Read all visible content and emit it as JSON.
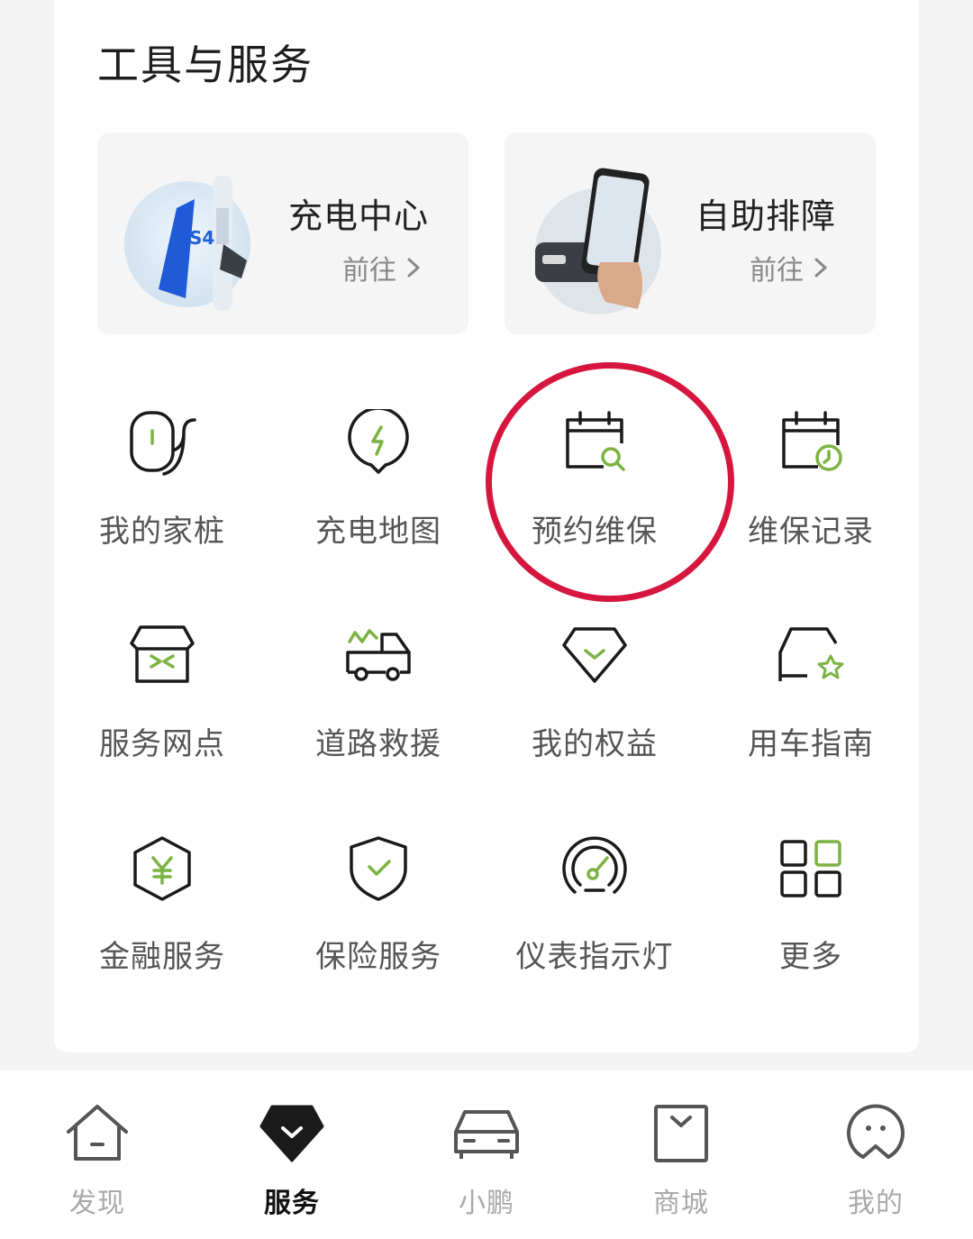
{
  "section": {
    "title": "工具与服务"
  },
  "features": [
    {
      "title": "充电中心",
      "link": "前往"
    },
    {
      "title": "自助排障",
      "link": "前往"
    }
  ],
  "tools": [
    {
      "label": "我的家桩",
      "icon": "home-charger-icon"
    },
    {
      "label": "充电地图",
      "icon": "charging-map-icon"
    },
    {
      "label": "预约维保",
      "icon": "maintenance-booking-icon"
    },
    {
      "label": "维保记录",
      "icon": "maintenance-record-icon"
    },
    {
      "label": "服务网点",
      "icon": "service-outlet-icon"
    },
    {
      "label": "道路救援",
      "icon": "road-rescue-icon"
    },
    {
      "label": "我的权益",
      "icon": "benefits-icon"
    },
    {
      "label": "用车指南",
      "icon": "car-guide-icon"
    },
    {
      "label": "金融服务",
      "icon": "finance-icon"
    },
    {
      "label": "保险服务",
      "icon": "insurance-icon"
    },
    {
      "label": "仪表指示灯",
      "icon": "dashboard-light-icon"
    },
    {
      "label": "更多",
      "icon": "more-grid-icon"
    }
  ],
  "tabs": [
    {
      "label": "发现",
      "icon": "home-icon",
      "active": false
    },
    {
      "label": "服务",
      "icon": "service-icon",
      "active": true
    },
    {
      "label": "小鹏",
      "icon": "car-icon",
      "active": false
    },
    {
      "label": "商城",
      "icon": "shop-bag-icon",
      "active": false
    },
    {
      "label": "我的",
      "icon": "profile-icon",
      "active": false
    }
  ],
  "colors": {
    "accent": "#7cb342",
    "highlight": "#d6163f",
    "icon_stroke": "#1a1a1a"
  }
}
